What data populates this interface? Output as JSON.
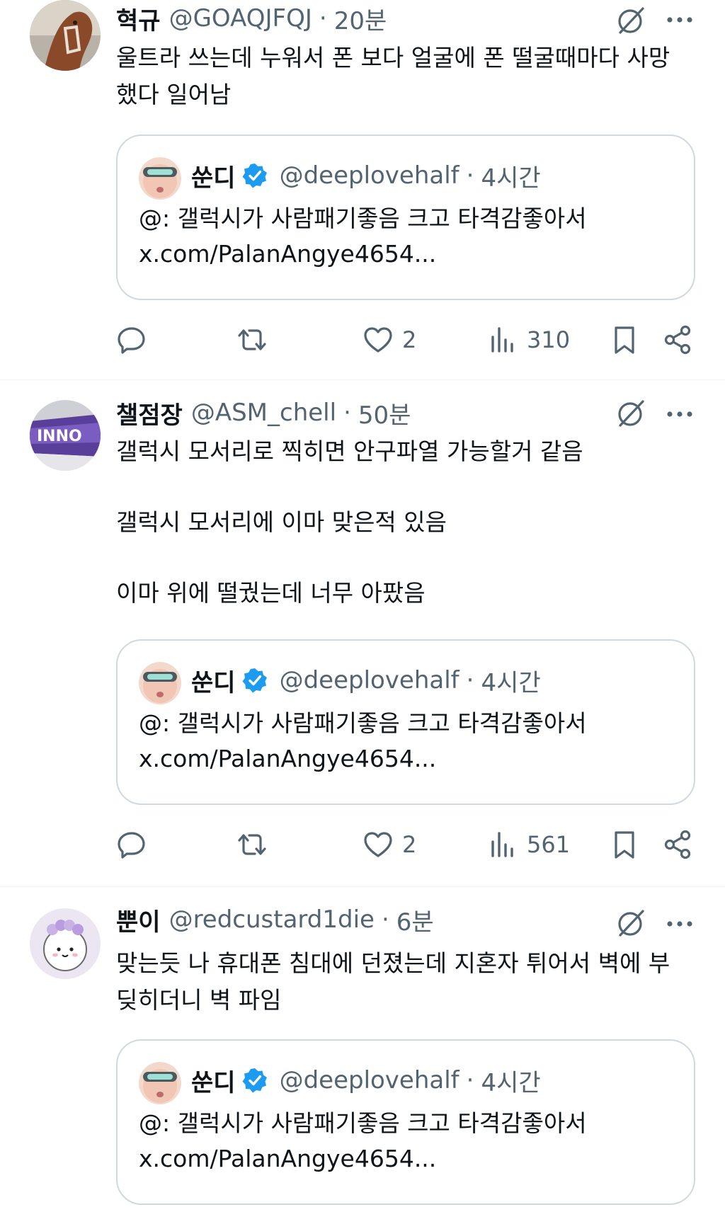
{
  "posts": [
    {
      "author_name": "혁규",
      "author_handle": "@GOAQJFQJ",
      "time_sep": "·",
      "time": "20분",
      "text": "울트라 쓰는데 누워서 폰 보다 얼굴에 폰 떨굴때마다 사망\n했다 일어남",
      "quote": {
        "name": "쑨디",
        "handle": "@deeplovehalf",
        "sep": "·",
        "time": "4시간",
        "text": "@: 갤럭시가 사람패기좋음 크고 타격감좋아서\nx.com/PalanAngye4654..."
      },
      "actions": {
        "likes": "2",
        "views": "310"
      }
    },
    {
      "author_name": "챌점장",
      "author_handle": "@ASM_chell",
      "time_sep": "·",
      "time": "50분",
      "text": "갤럭시 모서리로 찍히면 안구파열 가능할거 같음\n\n갤럭시 모서리에 이마 맞은적 있음\n\n이마 위에 떨궜는데 너무 아팠음",
      "quote": {
        "name": "쑨디",
        "handle": "@deeplovehalf",
        "sep": "·",
        "time": "4시간",
        "text": "@: 갤럭시가 사람패기좋음 크고 타격감좋아서\nx.com/PalanAngye4654..."
      },
      "actions": {
        "likes": "2",
        "views": "561"
      }
    },
    {
      "author_name": "뿐이",
      "author_handle": "@redcustard1die",
      "time_sep": "·",
      "time": "6분",
      "text": "맞는듯 나 휴대폰 침대에 던졌는데 지혼자 튀어서 벽에 부\n딪히더니 벽 파임",
      "quote": {
        "name": "쑨디",
        "handle": "@deeplovehalf",
        "sep": "·",
        "time": "4시간",
        "text": "@: 갤럭시가 사람패기좋음 크고 타격감좋아서\nx.com/PalanAngye4654..."
      }
    }
  ],
  "icons": {
    "grok": "grok-icon",
    "more": "more-dots-icon",
    "verified": "verified-badge-icon",
    "reply": "reply-icon",
    "repost": "repost-icon",
    "like": "heart-icon",
    "views": "views-icon",
    "bookmark": "bookmark-icon",
    "share": "share-icon"
  },
  "colors": {
    "text": "#0f1419",
    "secondary": "#536471",
    "border": "#cfd9de",
    "verified": "#1d9bf0"
  }
}
